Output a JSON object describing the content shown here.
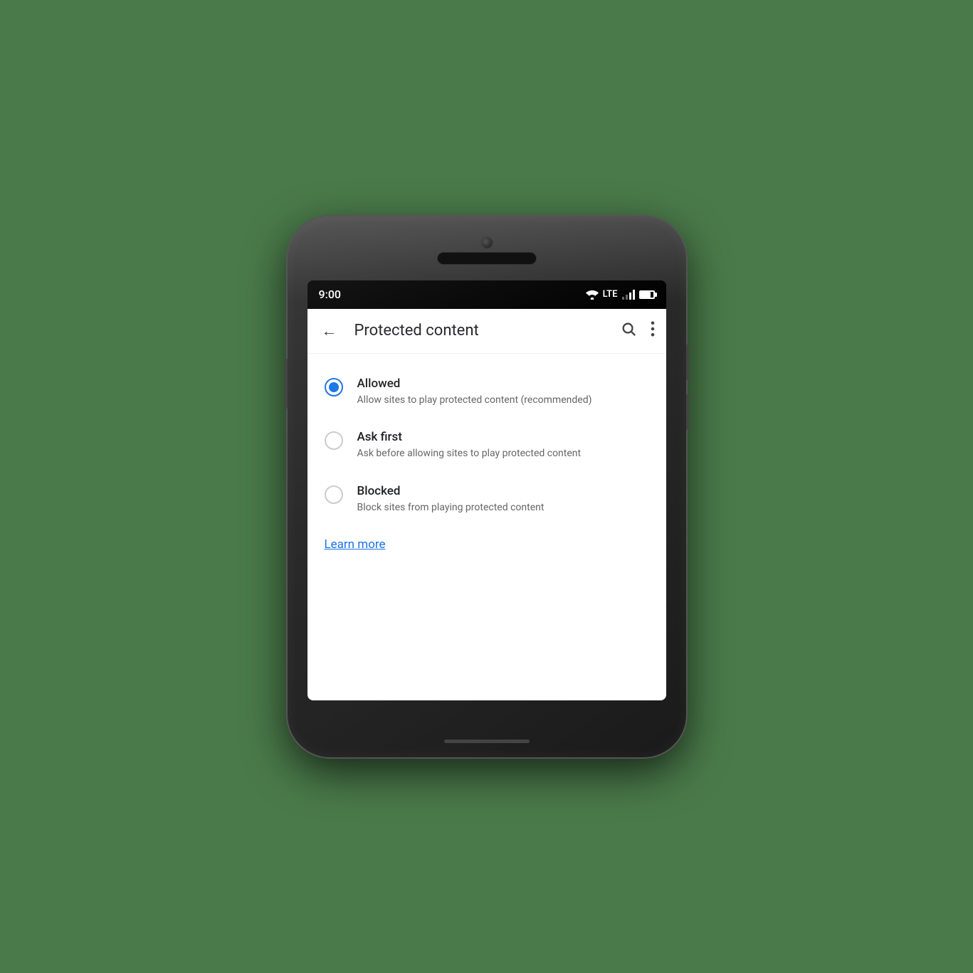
{
  "phone": {
    "status_bar": {
      "time": "9:00",
      "lte_label": "LTE"
    },
    "screen": {
      "title": "Protected content",
      "options": [
        {
          "id": "allowed",
          "label": "Allowed",
          "description": "Allow sites to play protected content (recommended)",
          "selected": true
        },
        {
          "id": "ask_first",
          "label": "Ask first",
          "description": "Ask before allowing sites to play protected content",
          "selected": false
        },
        {
          "id": "blocked",
          "label": "Blocked",
          "description": "Block sites from playing protected content",
          "selected": false
        }
      ],
      "learn_more_label": "Learn more"
    }
  }
}
